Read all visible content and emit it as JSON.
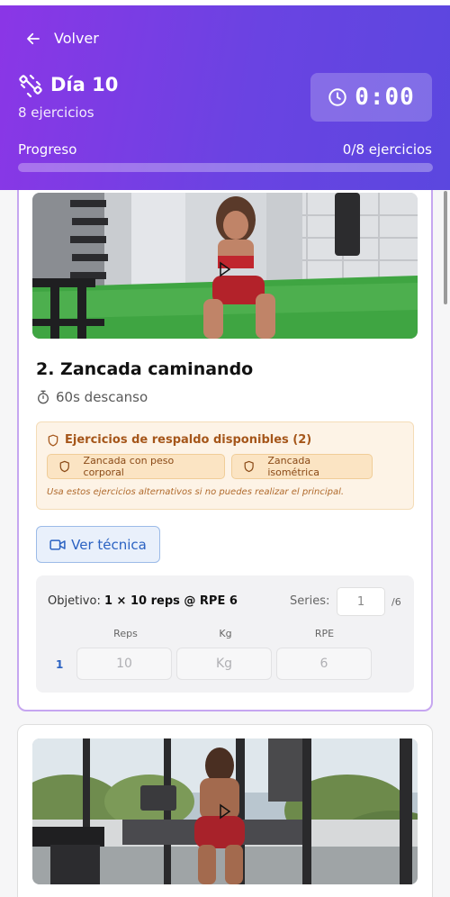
{
  "header": {
    "back_label": "Volver",
    "title": "Día 10",
    "subtitle": "8 ejercicios",
    "timer": "0:00",
    "progress_label": "Progreso",
    "progress_count": "0/8 ejercicios",
    "progress_value": 0
  },
  "exercise": {
    "title": "2. Zancada caminando",
    "rest": "60s descanso",
    "backup": {
      "heading": "Ejercicios de respaldo disponibles (2)",
      "options": [
        "Zancada con peso corporal",
        "Zancada isométrica"
      ],
      "note": "Usa estos ejercicios alternativos si no puedes realizar el principal."
    },
    "technique_button": "Ver técnica",
    "objective_prefix": "Objetivo:",
    "objective_value": "1 × 10 reps @ RPE 6",
    "series_label": "Series:",
    "series_value": "1",
    "series_total": "/6",
    "columns": [
      "Reps",
      "Kg",
      "RPE"
    ],
    "set": {
      "number": "1",
      "reps_placeholder": "10",
      "kg_placeholder": "Kg",
      "rpe_placeholder": "6"
    }
  },
  "icons": {
    "back": "arrow-left-icon",
    "title": "dumbbell-icon",
    "timer": "clock-icon",
    "rest": "stopwatch-icon",
    "backup": "shield-icon",
    "technique": "video-icon",
    "media_play": "play-icon"
  },
  "colors": {
    "header_start": "#8b36e6",
    "header_end": "#5b47df",
    "accent_blue": "#2b62c2",
    "backup_bg": "#fdf3e6",
    "backup_text": "#a5561a"
  }
}
